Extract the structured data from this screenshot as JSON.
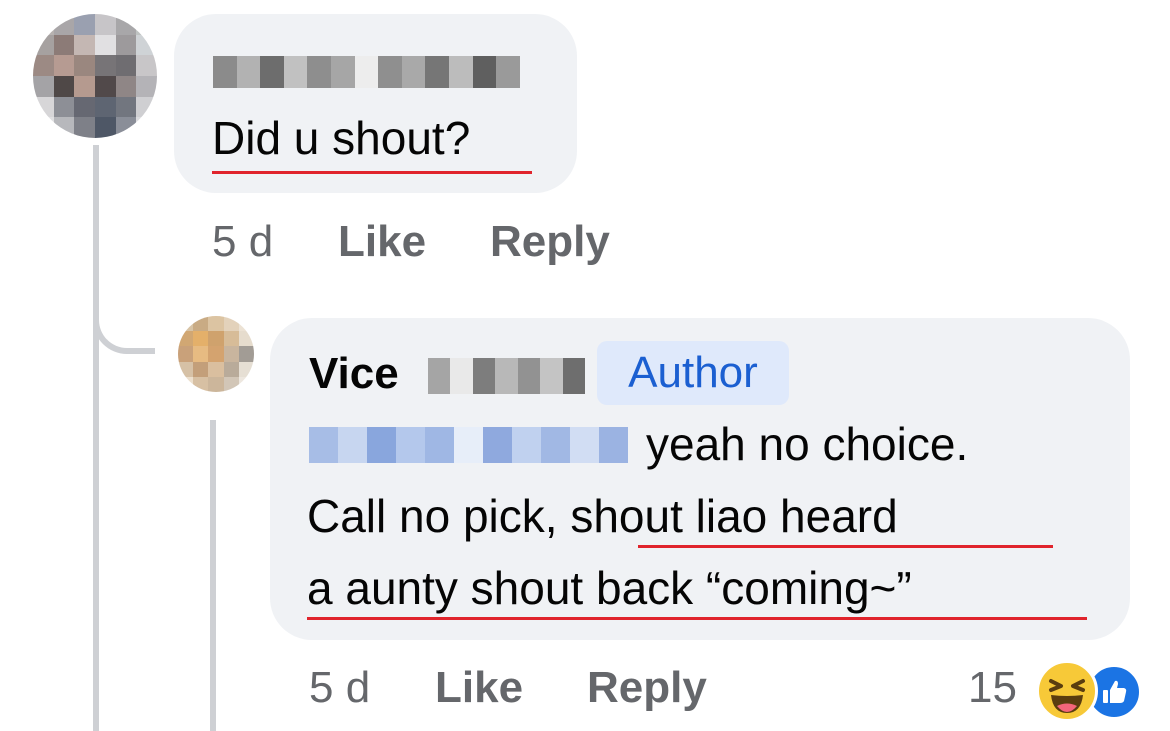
{
  "comment1": {
    "text": "Did u shout?",
    "time": "5 d",
    "like_label": "Like",
    "reply_label": "Reply"
  },
  "comment2": {
    "author_first": "Vice",
    "author_badge": "Author",
    "line1": "yeah no choice.",
    "line2_start": "Call no pick, ",
    "line2_end": "shout liao heard",
    "line3": "a aunty shout back “coming~”",
    "time": "5 d",
    "like_label": "Like",
    "reply_label": "Reply",
    "reaction_count": "15",
    "reactions": [
      "haha-icon",
      "like-icon"
    ]
  },
  "colors": {
    "bubble": "#f0f2f5",
    "underline": "#e0242c",
    "author_badge_bg": "#dfe9fb",
    "author_badge_text": "#1b5fd1",
    "meta_text": "#65676b"
  }
}
